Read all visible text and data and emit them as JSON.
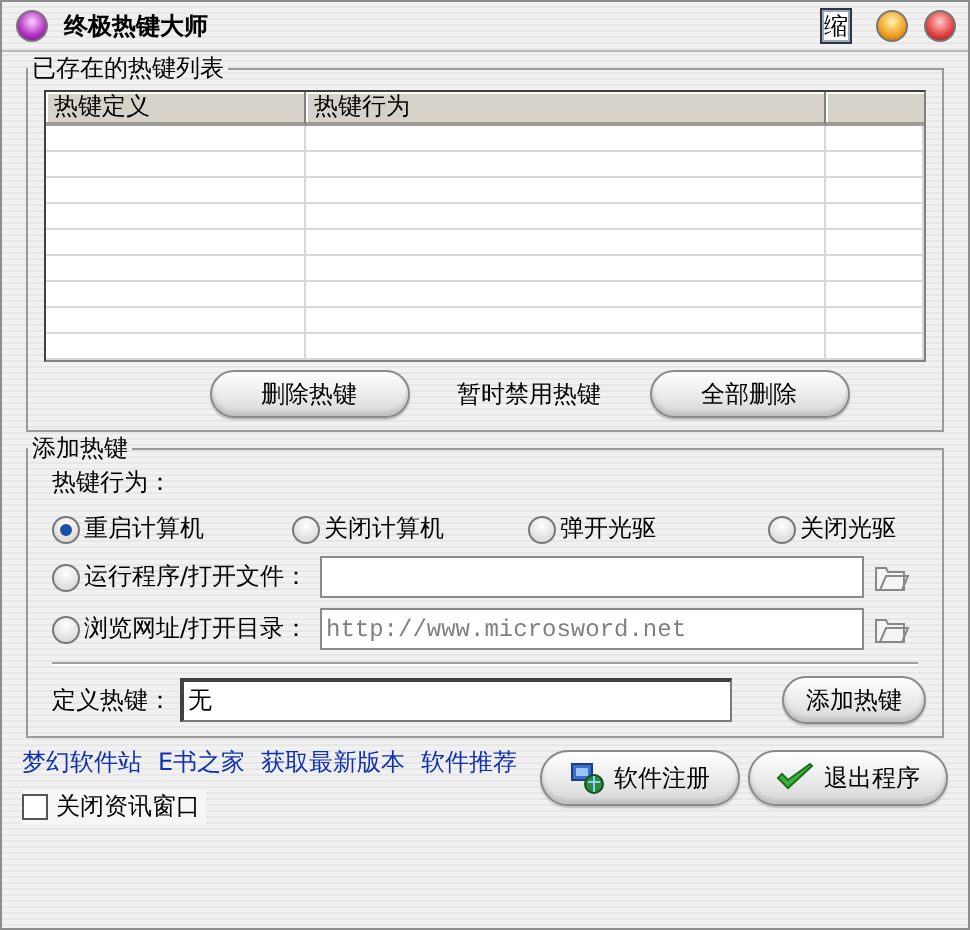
{
  "window": {
    "title": "终极热键大师",
    "title_buttons": [
      "缩"
    ]
  },
  "hotkey_list": {
    "legend": "已存在的热键列表",
    "columns": [
      "热键定义",
      "热键行为"
    ],
    "buttons": [
      {
        "kind": "button",
        "label": "删除热键"
      },
      {
        "kind": "text",
        "label": "暂时禁用热键"
      },
      {
        "kind": "button",
        "label": "全部删除"
      }
    ]
  },
  "add_hotkey": {
    "legend": "添加热键",
    "action_label": "热键行为：",
    "actions": [
      {
        "kind": "option",
        "label": "重启计算机",
        "selected": true
      },
      {
        "kind": "option",
        "label": "关闭计算机",
        "selected": false
      },
      {
        "kind": "option",
        "label": "弹开光驱",
        "selected": false
      },
      {
        "kind": "option",
        "label": "关闭光驱",
        "selected": false
      },
      {
        "kind": "field",
        "label": "运行程序/打开文件：",
        "selected": false
      },
      {
        "kind": "field",
        "label": "浏览网址/打开目录：",
        "selected": false,
        "value": "http://www.microsword.net"
      }
    ],
    "hotkey_field": {
      "label": "定义热键：",
      "value": "无"
    },
    "add_button": "添加热键"
  },
  "links": [
    "梦幻软件站",
    "E书之家",
    "获取最新版本",
    "软件推荐"
  ],
  "close_news": {
    "label": "关闭资讯窗口",
    "checked": false
  },
  "buttons": [
    {
      "label": "软件注册"
    },
    {
      "label": "退出程序"
    }
  ]
}
